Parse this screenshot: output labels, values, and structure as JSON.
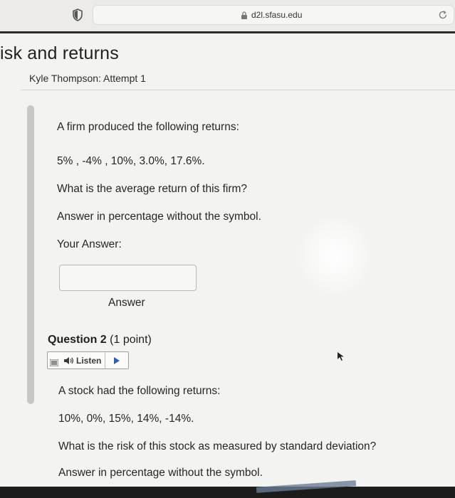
{
  "browser": {
    "url": "d2l.sfasu.edu"
  },
  "page": {
    "title": "isk and returns",
    "attempt": "Kyle Thompson: Attempt 1"
  },
  "question1": {
    "intro": "A firm produced the following returns:",
    "returns": "5% , -4% , 10%, 3.0%, 17.6%.",
    "prompt": "What is the average return of this firm?",
    "instructions": "Answer in percentage without the symbol.",
    "your_answer_label": "Your Answer:",
    "answer_value": "",
    "answer_caption": "Answer"
  },
  "question2": {
    "heading": "Question 2",
    "points": "(1 point)",
    "listen_label": "Listen",
    "intro": "A stock had the following returns:",
    "returns": "10%, 0%, 15%, 14%, -14%.",
    "prompt": "What is the risk of this stock as measured by standard deviation?",
    "instructions": "Answer in percentage without the symbol."
  },
  "icons": {
    "shield": "shield-icon",
    "lock": "lock-icon",
    "reload": "reload-icon",
    "menu": "menu-icon",
    "speaker": "speaker-icon",
    "play": "play-icon",
    "cursor": "cursor-icon"
  }
}
